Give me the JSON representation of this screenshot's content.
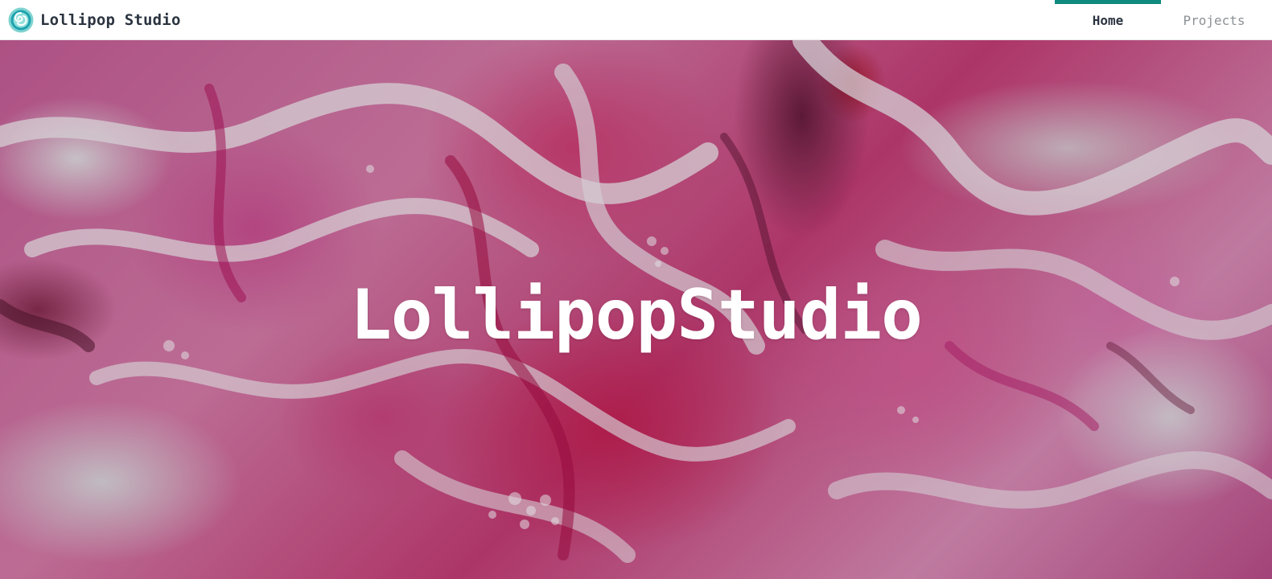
{
  "header": {
    "brand_name": "Lollipop Studio",
    "logo_icon": "lollipop-studio-logo-icon",
    "nav": [
      {
        "label": "Home",
        "active": true
      },
      {
        "label": "Projects",
        "active": false
      }
    ]
  },
  "hero": {
    "title": "LollipopStudio",
    "background": "pink-and-white-fluid-art-image"
  },
  "colors": {
    "accent": "#0f8a7e",
    "text_dark": "#2b3440",
    "text_muted": "#8c9196"
  }
}
